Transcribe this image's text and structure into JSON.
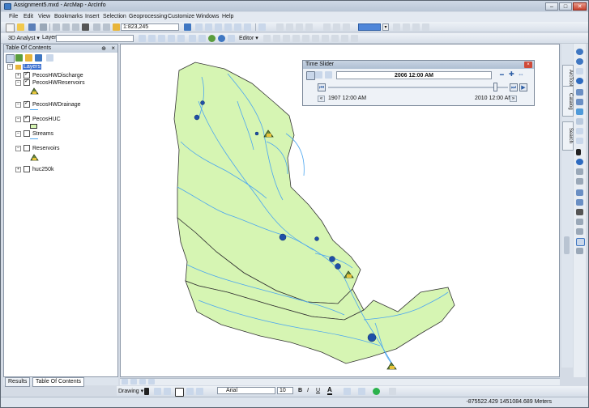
{
  "window": {
    "title": "Assignment5.mxd - ArcMap - ArcInfo"
  },
  "menu": [
    "File",
    "Edit",
    "View",
    "Bookmarks",
    "Insert",
    "Selection",
    "Geoprocessing",
    "Customize",
    "Windows",
    "Help"
  ],
  "toolbar": {
    "scale": "1:823,245",
    "analyst_label": "3D Analyst ▾",
    "layer_label": "Layer:",
    "editor_label": "Editor ▾"
  },
  "toc": {
    "title": "Table Of Contents",
    "root": "Layers",
    "layers": [
      {
        "name": "PecosHWDischarge",
        "checked": true
      },
      {
        "name": "PecosHWReservoirs",
        "checked": true
      },
      {
        "name": "PecosHWDrainage",
        "checked": true
      },
      {
        "name": "PecosHUC",
        "checked": true
      },
      {
        "name": "Streams",
        "checked": false
      },
      {
        "name": "Reservoirs",
        "checked": false
      },
      {
        "name": "huc250k",
        "checked": false
      }
    ]
  },
  "tabs": {
    "results": "Results",
    "toc": "Table Of Contents"
  },
  "right_tabs": [
    "ArcToolbox",
    "Catalog",
    "Search"
  ],
  "time_slider": {
    "title": "Time Slider",
    "current_time": "2006 12:00 AM",
    "start": "1907 12:00 AM",
    "end": "2010 12:00 AM",
    "position": 0.96
  },
  "drawing": {
    "label": "Drawing ▾",
    "font": "Arial",
    "size": "10",
    "bold": "B",
    "italic": "I",
    "underline": "U"
  },
  "status": {
    "coords": "-875522.429  1451084.689 Meters"
  },
  "colors": {
    "polygon": "#d6f5b3",
    "stream": "#4ca6f0",
    "point": "#1f4fa8"
  }
}
